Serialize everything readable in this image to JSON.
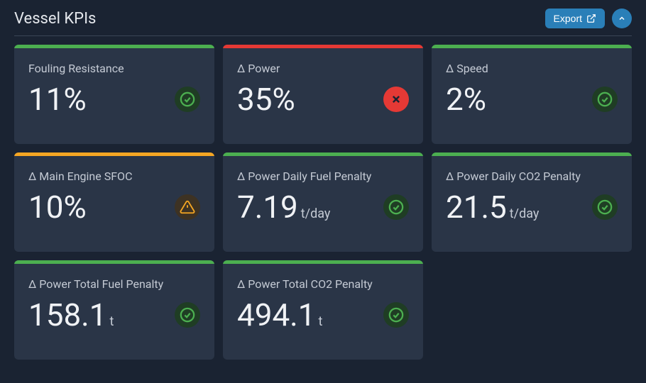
{
  "header": {
    "title": "Vessel KPIs",
    "export_label": "Export"
  },
  "colors": {
    "green": "#4caf50",
    "red": "#e53935",
    "orange": "#f5a623"
  },
  "cards": [
    {
      "label": "Fouling Resistance",
      "value": "11%",
      "unit": "",
      "bar": "green",
      "status": "ok"
    },
    {
      "label": "Δ Power",
      "value": "35%",
      "unit": "",
      "bar": "red",
      "status": "bad"
    },
    {
      "label": "Δ Speed",
      "value": "2%",
      "unit": "",
      "bar": "green",
      "status": "ok"
    },
    {
      "label": "Δ Main Engine SFOC",
      "value": "10%",
      "unit": "",
      "bar": "orange",
      "status": "warn"
    },
    {
      "label": "Δ Power Daily Fuel Penalty",
      "value": "7.19",
      "unit": "t/day",
      "bar": "green",
      "status": "ok"
    },
    {
      "label": "Δ Power Daily CO2 Penalty",
      "value": "21.5",
      "unit": "t/day",
      "bar": "green",
      "status": "ok"
    },
    {
      "label": "Δ Power Total Fuel Penalty",
      "value": "158.1",
      "unit": "t",
      "bar": "green",
      "status": "ok"
    },
    {
      "label": "Δ Power Total CO2 Penalty",
      "value": "494.1",
      "unit": "t",
      "bar": "green",
      "status": "ok"
    }
  ]
}
